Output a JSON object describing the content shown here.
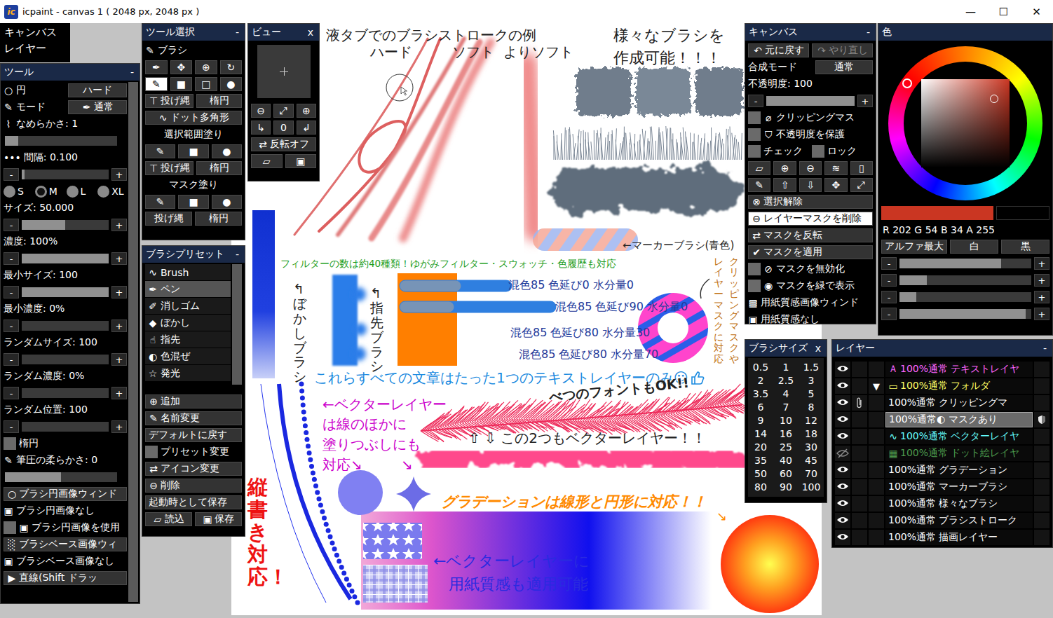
{
  "window": {
    "title": "icpaint - canvas 1 ( 2048 px, 2048 px )",
    "logo": "ic",
    "controls": [
      "—",
      "☐",
      "✕"
    ]
  },
  "menu": [
    "キャンバス",
    "レイヤー"
  ],
  "tool_panel": {
    "title": "ツール",
    "collapse": "-",
    "minus": "-",
    "plus": "+",
    "rows": [
      {
        "kind": "label-button",
        "icon": "○",
        "label": "円",
        "button": "ハード"
      },
      {
        "kind": "label-button",
        "icon": "✎",
        "label": "モード",
        "button_icon": "✒",
        "button": "通常"
      },
      {
        "kind": "text",
        "icon": "⌇",
        "label": "なめらかさ: 1"
      },
      {
        "kind": "bar",
        "level": 0.12
      },
      {
        "kind": "text",
        "icon": "•••",
        "label": "間隔: 0.100"
      },
      {
        "kind": "slider",
        "level": 0.03
      },
      {
        "kind": "sizes",
        "options": [
          {
            "label": "S",
            "selected": false
          },
          {
            "label": "M",
            "selected": true
          },
          {
            "label": "L",
            "selected": false
          },
          {
            "label": "XL",
            "selected": false
          }
        ]
      },
      {
        "kind": "text",
        "label": "サイズ: 50.000"
      },
      {
        "kind": "slider",
        "level": 0.5
      },
      {
        "kind": "text",
        "label": "濃度: 100%"
      },
      {
        "kind": "slider",
        "level": 1
      },
      {
        "kind": "text",
        "label": "最小サイズ: 100"
      },
      {
        "kind": "slider",
        "level": 1
      },
      {
        "kind": "text",
        "label": "最小濃度: 0%"
      },
      {
        "kind": "slider",
        "level": 0
      },
      {
        "kind": "text",
        "label": "ランダムサイズ: 100"
      },
      {
        "kind": "slider",
        "level": 0
      },
      {
        "kind": "text",
        "label": "ランダム濃度: 0%"
      },
      {
        "kind": "slider",
        "level": 0
      },
      {
        "kind": "text",
        "label": "ランダム位置: 100"
      },
      {
        "kind": "slider",
        "level": 0
      },
      {
        "kind": "check",
        "checked": false,
        "label": "楕円"
      },
      {
        "kind": "text",
        "icon": "✎",
        "label": "筆圧の柔らかさ: 0"
      },
      {
        "kind": "bar",
        "level": 0.5
      },
      {
        "kind": "button",
        "icon": "○",
        "label": "ブラシ円画像ウィンド"
      },
      {
        "kind": "text",
        "icon": "▣",
        "label": "ブラシ円画像なし"
      },
      {
        "kind": "check",
        "checked": false,
        "icon": "▣",
        "label": "ブラシ円画像を使用"
      },
      {
        "kind": "button",
        "icon": "░",
        "label": "ブラシベース画像ウィ"
      },
      {
        "kind": "text",
        "icon": "▣",
        "label": "ブラシベース画像なし"
      },
      {
        "kind": "button",
        "icon": "▶",
        "label": "直線(Shift ドラッ"
      }
    ]
  },
  "tool_select": {
    "title": "ツール選択",
    "collapse": "-",
    "rows": [
      {
        "kind": "text",
        "icon": "✎",
        "label": "ブラシ"
      },
      {
        "kind": "icons",
        "items": [
          {
            "icon": "✒",
            "selected": false
          },
          {
            "icon": "✥",
            "selected": false
          },
          {
            "icon": "⊕",
            "selected": false
          },
          {
            "icon": "↻",
            "selected": false
          }
        ]
      },
      {
        "kind": "icons",
        "items": [
          {
            "icon": "✎",
            "selected": true
          },
          {
            "icon": "■",
            "selected": false
          },
          {
            "icon": "□",
            "selected": false
          },
          {
            "icon": "●",
            "selected": false
          }
        ]
      },
      {
        "kind": "buttons",
        "items": [
          {
            "icon": "⊤",
            "label": "投げ縄"
          },
          {
            "label": "楕円"
          }
        ]
      },
      {
        "kind": "buttons",
        "items": [
          {
            "icon": "∿",
            "label": "ドット多角形"
          }
        ]
      },
      {
        "kind": "heading",
        "label": "選択範囲塗り"
      },
      {
        "kind": "icons",
        "items": [
          {
            "icon": "✎",
            "selected": false
          },
          {
            "icon": "■",
            "selected": false
          },
          {
            "icon": "●",
            "selected": false
          }
        ]
      },
      {
        "kind": "buttons",
        "items": [
          {
            "icon": "⊤",
            "label": "投げ縄"
          },
          {
            "label": "楕円"
          }
        ]
      },
      {
        "kind": "heading",
        "label": "マスク塗り"
      },
      {
        "kind": "icons",
        "items": [
          {
            "icon": "✎",
            "selected": false
          },
          {
            "icon": "■",
            "selected": false
          },
          {
            "icon": "●",
            "selected": false
          }
        ]
      },
      {
        "kind": "buttons",
        "items": [
          {
            "label": "投げ縄"
          },
          {
            "label": "楕円"
          }
        ]
      }
    ]
  },
  "view": {
    "title": "ビュー",
    "close": "x",
    "rows": [
      {
        "kind": "icons",
        "items": [
          {
            "icon": "⊖"
          },
          {
            "icon": "⤢"
          },
          {
            "icon": "⊕"
          }
        ]
      },
      {
        "kind": "icons",
        "items": [
          {
            "icon": "↳"
          },
          {
            "icon": "0"
          },
          {
            "icon": "↲"
          }
        ]
      },
      {
        "kind": "buttons",
        "items": [
          {
            "icon": "⇄",
            "label": "反転オフ"
          }
        ]
      },
      {
        "kind": "icons",
        "items": [
          {
            "icon": "▱"
          },
          {
            "icon": "▣"
          }
        ]
      }
    ]
  },
  "presets": {
    "title": "ブラシプリセット",
    "collapse": "-",
    "items": [
      {
        "icon": "∿",
        "label": "Brush",
        "selected": false
      },
      {
        "icon": "✒",
        "label": "ペン",
        "selected": true
      },
      {
        "icon": "✐",
        "label": "消しゴム",
        "selected": false
      },
      {
        "icon": "◆",
        "label": "ぼかし",
        "selected": false
      },
      {
        "icon": "☝",
        "label": "指先",
        "selected": false
      },
      {
        "icon": "◐",
        "label": "色混ぜ",
        "selected": false
      },
      {
        "icon": "☆",
        "label": "発光",
        "selected": false
      }
    ],
    "rows": [
      {
        "kind": "button",
        "icon": "⊕",
        "label": "追加"
      },
      {
        "kind": "button",
        "icon": "✎",
        "label": "名前変更"
      },
      {
        "kind": "button",
        "label": "デフォルトに戻す"
      },
      {
        "kind": "check",
        "checked": false,
        "label": "プリセット変更"
      },
      {
        "kind": "button",
        "icon": "⇄",
        "label": "アイコン変更"
      },
      {
        "kind": "button",
        "icon": "⊖",
        "label": "削除"
      },
      {
        "kind": "button",
        "label": "起動時として保存"
      },
      {
        "kind": "buttons",
        "items": [
          {
            "icon": "▱",
            "label": "読込"
          },
          {
            "icon": "▣",
            "label": "保存"
          }
        ]
      }
    ]
  },
  "canvas_panel": {
    "title": "キャンバス",
    "collapse": "-",
    "minus": "-",
    "plus": "+",
    "rows": [
      {
        "kind": "buttons",
        "items": [
          {
            "icon": "↶",
            "label": "元に戻す",
            "disabled": false
          },
          {
            "icon": "↷",
            "label": "やり直し",
            "disabled": true
          }
        ]
      },
      {
        "kind": "label-button",
        "label": "合成モード",
        "button": "通常"
      },
      {
        "kind": "text",
        "label": "不透明度: 100"
      },
      {
        "kind": "slider",
        "level": 1
      },
      {
        "kind": "check",
        "checked": false,
        "icon": "⌀",
        "label": "クリッピングマス"
      },
      {
        "kind": "check",
        "checked": false,
        "icon": "⛉",
        "label": "不透明度を保護"
      },
      {
        "kind": "check2",
        "items": [
          {
            "checked": false,
            "label": "チェック"
          },
          {
            "checked": false,
            "label": "ロック"
          }
        ]
      },
      {
        "kind": "icons",
        "items": [
          {
            "icon": "▱"
          },
          {
            "icon": "⊕"
          },
          {
            "icon": "⊖"
          },
          {
            "icon": "≋"
          },
          {
            "icon": "▯"
          }
        ]
      },
      {
        "kind": "icons",
        "items": [
          {
            "icon": "✎"
          },
          {
            "icon": "⇧"
          },
          {
            "icon": "⇩"
          },
          {
            "icon": "✥"
          },
          {
            "icon": "⤢"
          }
        ]
      },
      {
        "kind": "button",
        "icon": "⊗",
        "label": "選択解除",
        "highlighted": false
      },
      {
        "kind": "button",
        "icon": "⊖",
        "label": "レイヤーマスクを削除",
        "highlighted": true
      },
      {
        "kind": "button",
        "icon": "⇄",
        "label": "マスクを反転",
        "highlighted": false
      },
      {
        "kind": "button",
        "icon": "✔",
        "label": "マスクを適用",
        "highlighted": false
      },
      {
        "kind": "check",
        "checked": false,
        "icon": "⊘",
        "label": "マスクを無効化"
      },
      {
        "kind": "check",
        "checked": false,
        "icon": "◉",
        "label": "マスクを緑で表示"
      },
      {
        "kind": "text",
        "icon": "▩",
        "label": "用紙質感画像ウィンド"
      },
      {
        "kind": "text",
        "icon": "▣",
        "label": "用紙質感なし"
      }
    ]
  },
  "color_panel": {
    "title": "色",
    "foreground": "#ca3622",
    "background": "#000000",
    "readout": "R 202 G 54 B 34 A 255",
    "buttons": [
      "アルファ最大",
      "白",
      "黒"
    ],
    "minus": "-",
    "plus": "+",
    "sliders": [
      {
        "level": 0.77
      },
      {
        "level": 0.21
      },
      {
        "level": 0.13
      },
      {
        "level": 0.96
      }
    ]
  },
  "brush_sizes": {
    "title": "ブラシサイズ",
    "close": "x",
    "sizes": [
      "0.5",
      "1",
      "1.5",
      "2",
      "2.5",
      "3",
      "3.5",
      "4",
      "5",
      "6",
      "7",
      "8",
      "9",
      "10",
      "12",
      "14",
      "16",
      "18",
      "20",
      "25",
      "30",
      "35",
      "40",
      "45",
      "50",
      "60",
      "70",
      "80",
      "90",
      "100"
    ]
  },
  "layers": {
    "title": "レイヤー",
    "collapse": "-",
    "items": [
      {
        "visible": true,
        "clipping": false,
        "icon": "Ａ",
        "label": "100%通常 テキストレイヤ",
        "color": "#ff66ff",
        "selected": false,
        "mask": false
      },
      {
        "visible": true,
        "clipping": false,
        "expander": "▼",
        "icon": "▭",
        "label": "100%通常 フォルダ",
        "color": "#ffff66",
        "selected": false,
        "mask": false
      },
      {
        "visible": true,
        "clipping": true,
        "label": "100%通常 クリッピングマ",
        "color": "#ffffff",
        "selected": false,
        "mask": false
      },
      {
        "visible": true,
        "clipping": false,
        "label": "100%通常◐ マスクあり",
        "color": "#ffffff",
        "selected": true,
        "mask": true
      },
      {
        "visible": true,
        "clipping": false,
        "icon": "∿",
        "label": "100%通常 ベクターレイヤ",
        "color": "#66ffff",
        "selected": false,
        "mask": false
      },
      {
        "visible": false,
        "clipping": false,
        "icon": "▦",
        "label": "100%通常 ドット絵レイヤ",
        "color": "#4c9a4c",
        "selected": false,
        "mask": false
      },
      {
        "visible": true,
        "clipping": false,
        "label": "100%通常 グラデーション",
        "color": "#ffffff",
        "selected": false,
        "mask": false
      },
      {
        "visible": true,
        "clipping": false,
        "label": "100%通常 マーカーブラシ",
        "color": "#ffffff",
        "selected": false,
        "mask": false
      },
      {
        "visible": true,
        "clipping": false,
        "label": "100%通常 様々なブラシ",
        "color": "#ffffff",
        "selected": false,
        "mask": false
      },
      {
        "visible": true,
        "clipping": false,
        "label": "100%通常 ブラシストローク",
        "color": "#ffffff",
        "selected": false,
        "mask": false
      },
      {
        "visible": true,
        "clipping": false,
        "label": "100%通常 描画レイヤー",
        "color": "#ffffff",
        "selected": false,
        "mask": false
      }
    ]
  },
  "canvas": {
    "texts": [
      {
        "text": "液タブでのブラシストロークの例",
        "color": "#222222",
        "vertical": false
      },
      {
        "text": "ハード",
        "color": "#222222",
        "vertical": false
      },
      {
        "text": "ソフト",
        "color": "#222222",
        "vertical": false
      },
      {
        "text": "よりソフト",
        "color": "#222222",
        "vertical": false
      },
      {
        "text": "様々なブラシを",
        "color": "#222222",
        "vertical": false
      },
      {
        "text": "作成可能！！！",
        "color": "#222222",
        "vertical": false
      },
      {
        "text": "←マーカーブラシ(青色)",
        "color": "#222222",
        "vertical": false
      },
      {
        "text": "フィルターの数は約40種類！ゆがみフィルター・スウォッチ・色履歴も対応",
        "color": "#1e9e1e",
        "vertical": false
      },
      {
        "text": "↰ぼかしブラシ",
        "color": "#222222",
        "vertical": true
      },
      {
        "text": "↰指先ブラシ",
        "color": "#222222",
        "vertical": true
      },
      {
        "text": "混色85 色延び0 水分量0",
        "color": "#1f3a9a",
        "vertical": false
      },
      {
        "text": "混色85 色延び90 水分量0",
        "color": "#1f3a9a",
        "vertical": false
      },
      {
        "text": "混色85 色延び80 水分量30",
        "color": "#1f3a9a",
        "vertical": false
      },
      {
        "text": "混色85 色延び80 水分量70",
        "color": "#1f3a9a",
        "vertical": false
      },
      {
        "text": "クリッピングマスクや",
        "color": "#c07010",
        "vertical": true
      },
      {
        "text": "レイヤーマスクに対応",
        "color": "#c07010",
        "vertical": true
      },
      {
        "text": "これらすべての文章はたった1つのテキストレイヤーのみ☺",
        "color": "#1a8ae0",
        "vertical": false
      },
      {
        "text": "べつのフォントもOK!!",
        "color": "#222222",
        "vertical": false
      },
      {
        "text": "←ベクターレイヤー",
        "color": "#cc00cc",
        "vertical": false
      },
      {
        "text": "は線のほかに",
        "color": "#cc00cc",
        "vertical": false
      },
      {
        "text": "塗りつぶしにも",
        "color": "#cc00cc",
        "vertical": false
      },
      {
        "text": "対応↘",
        "color": "#cc00cc",
        "vertical": false
      },
      {
        "text": "↘",
        "color": "#cc00cc",
        "vertical": false
      },
      {
        "text": "⇧ ⇩ この2つもベクターレイヤー！！",
        "color": "#222222",
        "vertical": false
      },
      {
        "text": "縦書き対応！",
        "color": "#ee1111",
        "vertical": true
      },
      {
        "text": "グラデーションは線形と円形に対応！！",
        "color": "#ff8a00",
        "vertical": false
      },
      {
        "text": "↘",
        "color": "#ff8a00",
        "vertical": false
      },
      {
        "text": "←ベクターレイヤーに",
        "color": "#2a2ae0",
        "vertical": false
      },
      {
        "text": "用紙質感も適用可能",
        "color": "#2a2ae0",
        "vertical": false
      }
    ]
  }
}
